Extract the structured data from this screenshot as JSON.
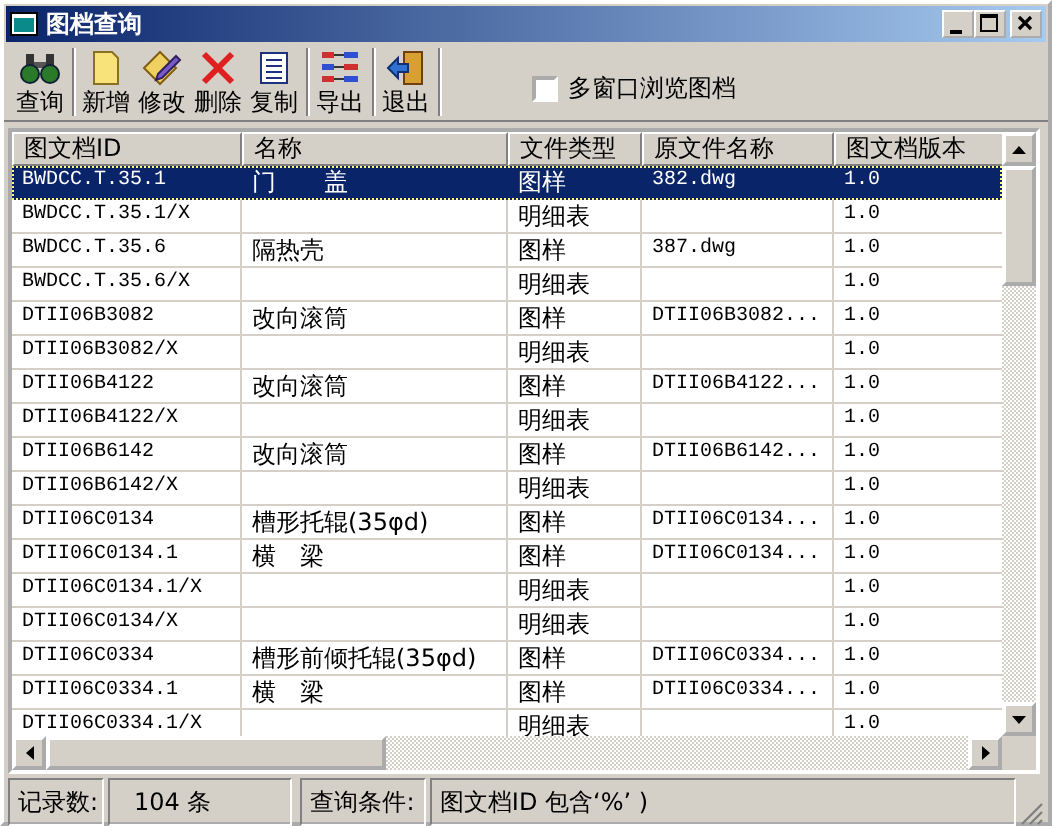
{
  "window": {
    "title": "图档查询"
  },
  "toolbar": {
    "groups": [
      [
        {
          "kind": "search",
          "label": "查询"
        }
      ],
      [
        {
          "kind": "new",
          "label": "新增"
        },
        {
          "kind": "edit",
          "label": "修改"
        },
        {
          "kind": "delete",
          "label": "删除"
        },
        {
          "kind": "copy",
          "label": "复制"
        }
      ],
      [
        {
          "kind": "export",
          "label": "导出"
        }
      ],
      [
        {
          "kind": "exit",
          "label": "退出"
        }
      ]
    ],
    "checkbox": {
      "label": "多窗口浏览图档",
      "checked": false
    }
  },
  "table": {
    "columns": [
      "图文档ID",
      "名称",
      "文件类型",
      "原文件名称",
      "图文档版本"
    ],
    "rows": [
      {
        "selected": true,
        "cells": [
          "BWDCC.T.35.1",
          "门　　盖",
          "图样",
          "382.dwg",
          "1.0"
        ]
      },
      {
        "selected": false,
        "cells": [
          "BWDCC.T.35.1/X",
          "",
          "明细表",
          "",
          "1.0"
        ]
      },
      {
        "selected": false,
        "cells": [
          "BWDCC.T.35.6",
          "隔热壳",
          "图样",
          "387.dwg",
          "1.0"
        ]
      },
      {
        "selected": false,
        "cells": [
          "BWDCC.T.35.6/X",
          "",
          "明细表",
          "",
          "1.0"
        ]
      },
      {
        "selected": false,
        "cells": [
          "DTII06B3082",
          "改向滚筒",
          "图样",
          "DTII06B3082...",
          "1.0"
        ]
      },
      {
        "selected": false,
        "cells": [
          "DTII06B3082/X",
          "",
          "明细表",
          "",
          "1.0"
        ]
      },
      {
        "selected": false,
        "cells": [
          "DTII06B4122",
          "改向滚筒",
          "图样",
          "DTII06B4122...",
          "1.0"
        ]
      },
      {
        "selected": false,
        "cells": [
          "DTII06B4122/X",
          "",
          "明细表",
          "",
          "1.0"
        ]
      },
      {
        "selected": false,
        "cells": [
          "DTII06B6142",
          "改向滚筒",
          "图样",
          "DTII06B6142...",
          "1.0"
        ]
      },
      {
        "selected": false,
        "cells": [
          "DTII06B6142/X",
          "",
          "明细表",
          "",
          "1.0"
        ]
      },
      {
        "selected": false,
        "cells": [
          "DTII06C0134",
          "槽形托辊(35φd)",
          "图样",
          "DTII06C0134...",
          "1.0"
        ]
      },
      {
        "selected": false,
        "cells": [
          "DTII06C0134.1",
          "横　梁",
          "图样",
          "DTII06C0134...",
          "1.0"
        ]
      },
      {
        "selected": false,
        "cells": [
          "DTII06C0134.1/X",
          "",
          "明细表",
          "",
          "1.0"
        ]
      },
      {
        "selected": false,
        "cells": [
          "DTII06C0134/X",
          "",
          "明细表",
          "",
          "1.0"
        ]
      },
      {
        "selected": false,
        "cells": [
          "DTII06C0334",
          "槽形前倾托辊(35φd)",
          "图样",
          "DTII06C0334...",
          "1.0"
        ]
      },
      {
        "selected": false,
        "cells": [
          "DTII06C0334.1",
          "横　梁",
          "图样",
          "DTII06C0334...",
          "1.0"
        ]
      },
      {
        "selected": false,
        "cells": [
          "DTII06C0334.1/X",
          "",
          "明细表",
          "",
          "1.0"
        ]
      }
    ]
  },
  "status_bar": [
    {
      "label": "记录数:",
      "value": "104 条"
    },
    {
      "label": "查询条件:",
      "value": "图文档ID 包含‘%’ )"
    }
  ]
}
